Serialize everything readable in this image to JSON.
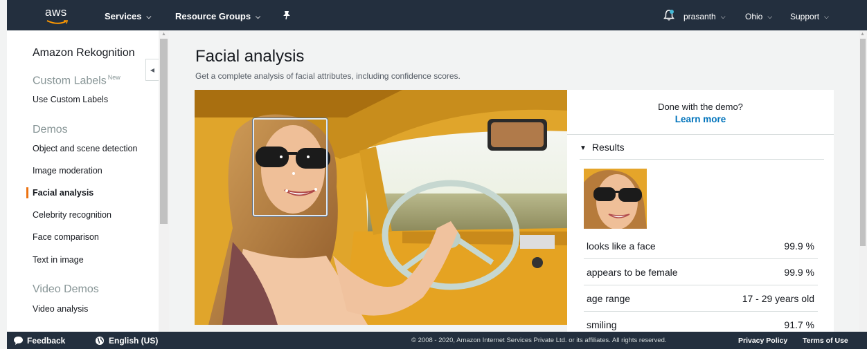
{
  "topnav": {
    "logo_text": "aws",
    "services": "Services",
    "resource_groups": "Resource Groups",
    "user": "prasanth",
    "region": "Ohio",
    "support": "Support"
  },
  "sidebar": {
    "service_title": "Amazon Rekognition",
    "custom_labels": {
      "heading": "Custom Labels",
      "badge": "New",
      "items": [
        "Use Custom Labels"
      ]
    },
    "demos": {
      "heading": "Demos",
      "items": [
        "Object and scene detection",
        "Image moderation",
        "Facial analysis",
        "Celebrity recognition",
        "Face comparison",
        "Text in image"
      ],
      "active": "Facial analysis"
    },
    "video_demos": {
      "heading": "Video Demos",
      "items": [
        "Video analysis"
      ]
    }
  },
  "main": {
    "title": "Facial analysis",
    "subtitle": "Get a complete analysis of facial attributes, including confidence scores."
  },
  "results_panel": {
    "done_text": "Done with the demo?",
    "learn_more": "Learn more",
    "results_label": "Results",
    "attributes": [
      {
        "label": "looks like a face",
        "value": "99.9 %"
      },
      {
        "label": "appears to be female",
        "value": "99.9 %"
      },
      {
        "label": "age range",
        "value": "17 - 29 years old"
      },
      {
        "label": "smiling",
        "value": "91.7 %"
      }
    ]
  },
  "footer": {
    "feedback": "Feedback",
    "language": "English (US)",
    "copyright": "© 2008 - 2020, Amazon Internet Services Private Ltd. or its affiliates. All rights reserved.",
    "privacy": "Privacy Policy",
    "terms": "Terms of Use"
  },
  "colors": {
    "nav_bg": "#232f3e",
    "accent_orange": "#ec7211",
    "link_blue": "#0073bb"
  }
}
